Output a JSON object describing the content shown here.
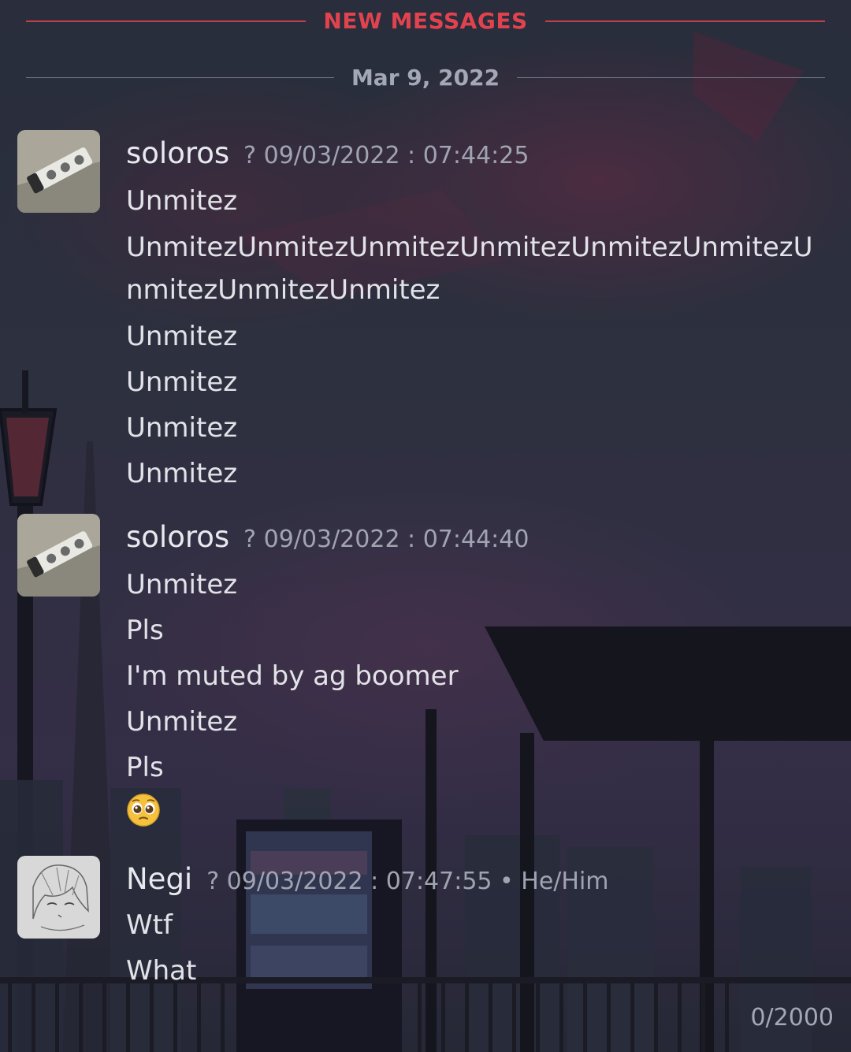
{
  "dividers": {
    "new_messages": "NEW MESSAGES",
    "date": "Mar 9, 2022"
  },
  "messages": [
    {
      "username": "soloros",
      "meta": "? 09/03/2022 : 07:44:25",
      "avatar_icon": "power-strip-avatar",
      "lines": [
        "Unmitez",
        "UnmitezUnmitezUnmitezUnmitezUnmitezUnmitezUnmitezUnmitezUnmitez",
        "Unmitez",
        "Unmitez",
        "Unmitez",
        "Unmitez"
      ]
    },
    {
      "username": "soloros",
      "meta": "? 09/03/2022 : 07:44:40",
      "avatar_icon": "power-strip-avatar",
      "lines": [
        "Unmitez",
        "Pls",
        "I'm muted by ag boomer",
        "Unmitez",
        "Pls"
      ],
      "emoji": "pleading-face-emoji"
    },
    {
      "username": "Negi",
      "meta": "? 09/03/2022 : 07:47:55 • He/Him",
      "avatar_icon": "anime-sketch-avatar",
      "lines": [
        "Wtf",
        "What"
      ]
    }
  ],
  "composer": {
    "char_counter": "0/2000"
  },
  "colors": {
    "new_messages_accent": "#e0434e",
    "text": "#e2e3e8",
    "muted": "#a0a4b2"
  }
}
